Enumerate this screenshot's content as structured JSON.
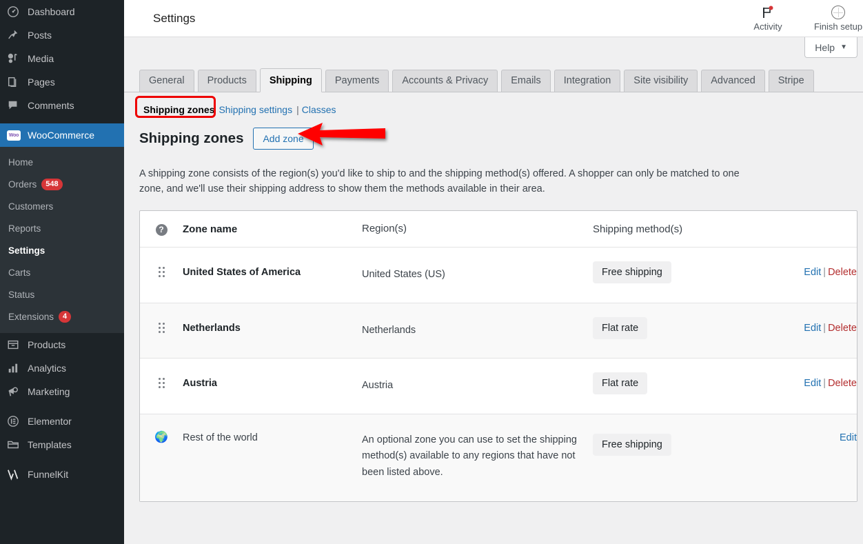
{
  "sidebar": {
    "items": [
      {
        "label": "Dashboard",
        "icon": "dashboard-icon",
        "current": false
      },
      {
        "label": "Posts",
        "icon": "pin-icon",
        "current": false
      },
      {
        "label": "Media",
        "icon": "media-icon",
        "current": false
      },
      {
        "label": "Pages",
        "icon": "pages-icon",
        "current": false
      },
      {
        "label": "Comments",
        "icon": "comments-icon",
        "current": false
      },
      {
        "label": "WooCommerce",
        "icon": "woocommerce-icon",
        "current": true
      },
      {
        "label": "Products",
        "icon": "products-icon",
        "current": false
      },
      {
        "label": "Analytics",
        "icon": "analytics-icon",
        "current": false
      },
      {
        "label": "Marketing",
        "icon": "marketing-icon",
        "current": false
      },
      {
        "label": "Elementor",
        "icon": "elementor-icon",
        "current": false
      },
      {
        "label": "Templates",
        "icon": "templates-icon",
        "current": false
      },
      {
        "label": "FunnelKit",
        "icon": "funnelkit-icon",
        "current": false
      }
    ],
    "submenu": [
      {
        "label": "Home",
        "badge": "",
        "active": false
      },
      {
        "label": "Orders",
        "badge": "548",
        "active": false
      },
      {
        "label": "Customers",
        "badge": "",
        "active": false
      },
      {
        "label": "Reports",
        "badge": "",
        "active": false
      },
      {
        "label": "Settings",
        "badge": "",
        "active": true
      },
      {
        "label": "Carts",
        "badge": "",
        "active": false
      },
      {
        "label": "Status",
        "badge": "",
        "active": false
      },
      {
        "label": "Extensions",
        "badge": "4",
        "active": false
      }
    ],
    "woo_logo_text": "Woo"
  },
  "topbar": {
    "title": "Settings",
    "activity_label": "Activity",
    "finish_setup_label": "Finish setup"
  },
  "help": {
    "label": "Help",
    "caret": "▼"
  },
  "tabs": [
    {
      "label": "General",
      "active": false
    },
    {
      "label": "Products",
      "active": false
    },
    {
      "label": "Shipping",
      "active": true
    },
    {
      "label": "Payments",
      "active": false
    },
    {
      "label": "Accounts & Privacy",
      "active": false
    },
    {
      "label": "Emails",
      "active": false
    },
    {
      "label": "Integration",
      "active": false
    },
    {
      "label": "Site visibility",
      "active": false
    },
    {
      "label": "Advanced",
      "active": false
    },
    {
      "label": "Stripe",
      "active": false
    }
  ],
  "subnav": {
    "current": "Shipping zones",
    "links": [
      {
        "label": "Shipping settings"
      },
      {
        "label": "Classes"
      }
    ],
    "separator": "|"
  },
  "zones": {
    "heading": "Shipping zones",
    "add_button": "Add zone",
    "description": "A shipping zone consists of the region(s) you'd like to ship to and the shipping method(s) offered. A shopper can only be matched to one zone, and we'll use their shipping address to show them the methods available in their area.",
    "columns": {
      "help_icon": "?",
      "name": "Zone name",
      "region": "Region(s)",
      "method": "Shipping method(s)"
    },
    "rows": [
      {
        "name": "United States of America",
        "region": "United States (US)",
        "method": "Free shipping",
        "edit": "Edit",
        "delete": "Delete",
        "handle": "drag-handle-icon",
        "alt": false
      },
      {
        "name": "Netherlands",
        "region": "Netherlands",
        "method": "Flat rate",
        "edit": "Edit",
        "delete": "Delete",
        "handle": "drag-handle-icon",
        "alt": true
      },
      {
        "name": "Austria",
        "region": "Austria",
        "method": "Flat rate",
        "edit": "Edit",
        "delete": "Delete",
        "handle": "drag-handle-icon",
        "alt": false
      }
    ],
    "rest_of_world": {
      "name": "Rest of the world",
      "region": "An optional zone you can use to set the shipping method(s) available to any regions that have not been listed above.",
      "method": "Free shipping",
      "edit": "Edit",
      "icon": "globe-icon"
    }
  },
  "annotations": {
    "highlight_color": "#ee0000",
    "arrow_color": "#ff0000",
    "arrow_target": "Add zone"
  },
  "colors": {
    "sidebar_bg": "#1d2327",
    "accent_blue": "#2271b1",
    "badge_red": "#d63638",
    "delete_red": "#b32d2e"
  }
}
